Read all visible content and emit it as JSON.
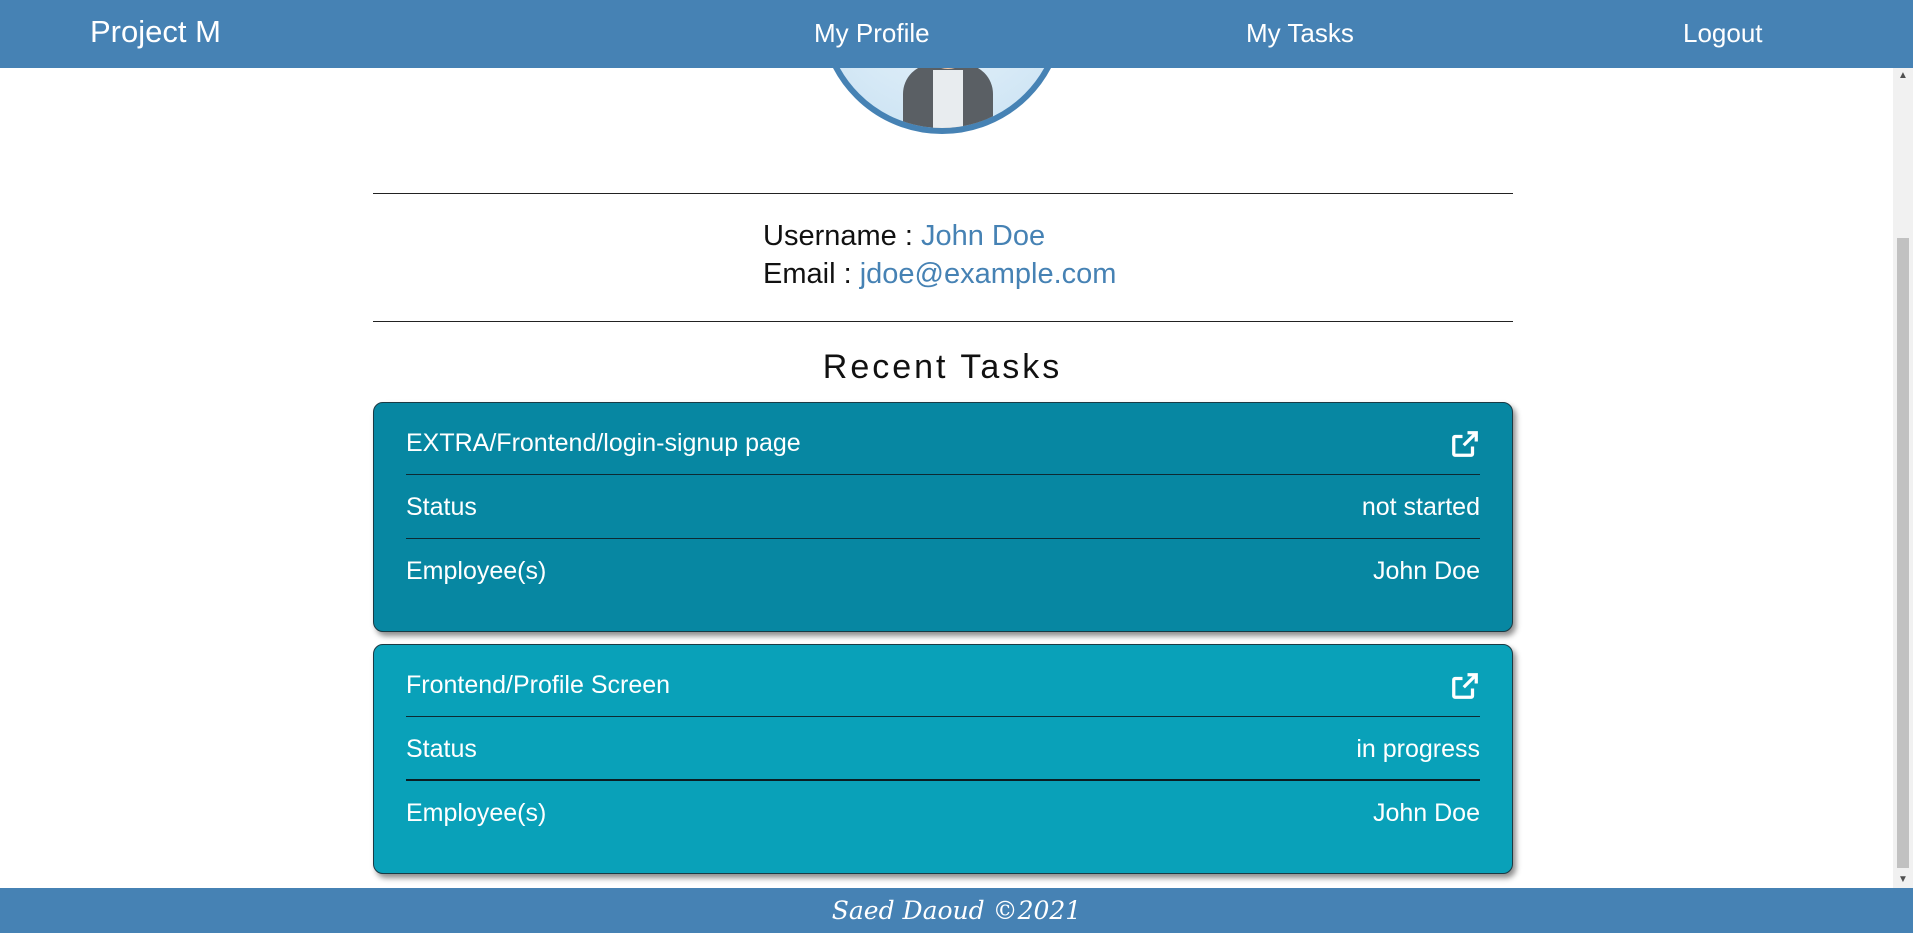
{
  "nav": {
    "brand": "Project M",
    "links": [
      "My Profile",
      "My Tasks",
      "Logout"
    ]
  },
  "profile": {
    "username_label": "Username :",
    "username": "John Doe",
    "email_label": "Email :",
    "email": "jdoe@example.com"
  },
  "section_title": "Recent Tasks",
  "tasks": [
    {
      "title": "EXTRA/Frontend/login-signup page",
      "status_label": "Status",
      "status": "not started",
      "employees_label": "Employee(s)",
      "employees": "John Doe"
    },
    {
      "title": "Frontend/Profile Screen",
      "status_label": "Status",
      "status": "in progress",
      "employees_label": "Employee(s)",
      "employees": "John Doe"
    }
  ],
  "footer": "Saed Daoud ©2021",
  "icons": [
    "avatar-image",
    "external-link-icon",
    "scroll-up-arrow",
    "scroll-down-arrow"
  ],
  "colors": {
    "primary": "#4682b4",
    "card1": "#0787a2",
    "card2": "#09a1b9"
  }
}
